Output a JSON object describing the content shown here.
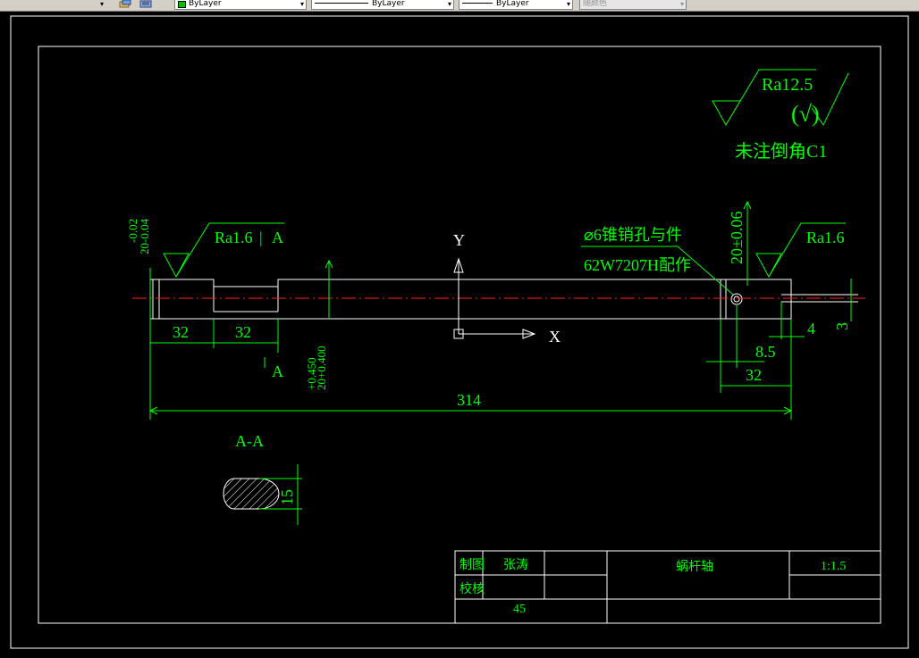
{
  "toolbar": {
    "layer_combo_value": "ByLayer",
    "linetype_combo_value": "ByLayer",
    "lineweight_combo_value": "ByLayer",
    "plotstyle_combo_value": "随颜色",
    "colors": {
      "bylayer_swatch": "#00c000"
    }
  },
  "drawing": {
    "roughness_main": "Ra12.5",
    "roughness_bracket": "(√)",
    "chamfer_note": "未注倒角C1",
    "roughness_left": "Ra1.6",
    "section_mark_top": "A",
    "section_mark_bottom": "A",
    "roughness_right": "Ra1.6",
    "tol_left_upper": "-0.02",
    "tol_left_lower": "20-0.04",
    "tol_mid_upper": "+0.450",
    "tol_mid_lower": "20+0.400",
    "tol_right": "20±0.06",
    "axis_y_label": "Y",
    "axis_x_label": "X",
    "pin_note_line1": "⌀6锥销孔与件",
    "pin_note_line2": "62W7207H配作",
    "dim_32_a": "32",
    "dim_32_b": "32",
    "dim_314": "314",
    "dim_4": "4",
    "dim_3": "3",
    "dim_8_5": "8.5",
    "dim_32_c": "32",
    "section_title": "A-A",
    "dim_15": "15"
  },
  "title_block": {
    "drawn_label": "制图",
    "drawn_name": "张涛",
    "checked_label": "校核",
    "part_name": "蜗杆轴",
    "scale": "1:1.5",
    "material": "45"
  }
}
